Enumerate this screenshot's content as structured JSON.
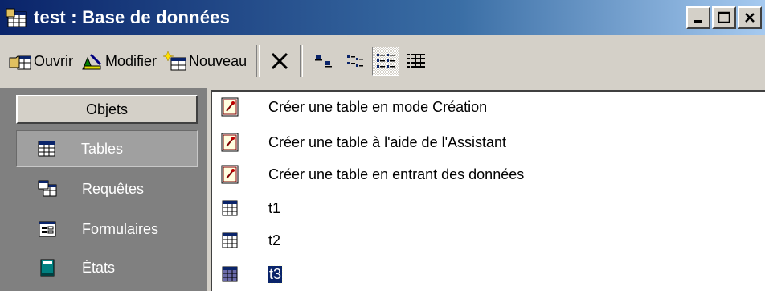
{
  "window": {
    "title": "test : Base de données"
  },
  "toolbar": {
    "open_label": "Ouvrir",
    "modify_label": "Modifier",
    "new_label": "Nouveau"
  },
  "objects_panel": {
    "header": "Objets",
    "items": [
      {
        "label": "Tables",
        "icon": "table-icon",
        "active": true
      },
      {
        "label": "Requêtes",
        "icon": "query-icon"
      },
      {
        "label": "Formulaires",
        "icon": "form-icon"
      },
      {
        "label": "États",
        "icon": "report-icon"
      }
    ]
  },
  "list": {
    "items": [
      {
        "label": "Créer une table en mode Création",
        "icon": "wizard-icon"
      },
      {
        "label": "Créer une table à l'aide de l'Assistant",
        "icon": "wizard-icon"
      },
      {
        "label": "Créer une table en entrant des données",
        "icon": "wizard-icon"
      },
      {
        "label": "t1",
        "icon": "table-icon"
      },
      {
        "label": "t2",
        "icon": "table-icon"
      },
      {
        "label": "t3",
        "icon": "table-icon",
        "selected": true
      }
    ]
  },
  "colors": {
    "title_start": "#0a246a",
    "title_end": "#a6caf0",
    "selection": "#0a246a"
  }
}
